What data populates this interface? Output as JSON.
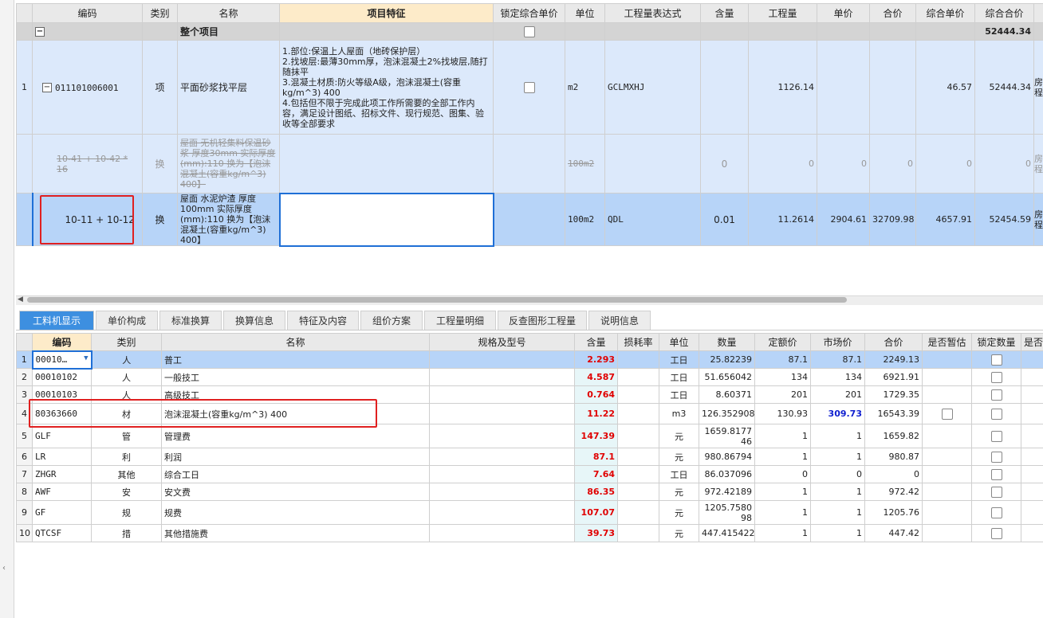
{
  "top_grid": {
    "headers": [
      "编码",
      "类别",
      "名称",
      "项目特征",
      "锁定综合单价",
      "单位",
      "工程量表达式",
      "含量",
      "工程量",
      "单价",
      "合价",
      "综合单价",
      "综合合价"
    ],
    "total_row": {
      "label": "整个项目",
      "total": "52444.34"
    },
    "row1": {
      "num": "1",
      "code": "011101006001",
      "type": "项",
      "name": "平面砂浆找平层",
      "feature": "1.部位:保温上人屋面（地砖保护层）\n2.找坡层:最薄30mm厚，泡沫混凝土2%找坡层,随打随抹平\n3.混凝土材质:防火等级A级，泡沫混凝土(容重kg/m^3) 400\n4.包括但不限于完成此项工作所需要的全部工作内容，满足设计图纸、招标文件、现行规范、图集、验收等全部要求",
      "unit": "m2",
      "expr": "GCLMXHJ",
      "quantity": "1126.14",
      "comp_price": "46.57",
      "comp_total": "52444.34",
      "extra": "房\n程"
    },
    "row2": {
      "code": "10-41 + 10-42 * 16",
      "type": "换",
      "name": "屋面 无机轻集料保温砂浆 厚度30mm  实际厚度(mm):110  换为【泡沫混凝土(容重kg/m^3) 400】",
      "unit": "100m2",
      "content": "0",
      "quantity": "0",
      "price": "0",
      "total": "0",
      "comp_price": "0",
      "comp_total": "0",
      "extra": "房\n程"
    },
    "row3": {
      "code": "10-11 + 10-12",
      "type": "换",
      "name": "屋面 水泥炉渣 厚度100mm  实际厚度(mm):110  换为【泡沫混凝土(容重kg/m^3) 400】",
      "unit": "100m2",
      "expr": "QDL",
      "content": "0.01",
      "quantity": "11.2614",
      "price": "2904.61",
      "total": "32709.98",
      "comp_price": "4657.91",
      "comp_total": "52454.59",
      "extra": "房\n程"
    }
  },
  "tabs": [
    "工料机显示",
    "单价构成",
    "标准换算",
    "换算信息",
    "特征及内容",
    "组价方案",
    "工程量明细",
    "反查图形工程量",
    "说明信息"
  ],
  "bottom_grid": {
    "headers": [
      "编码",
      "类别",
      "名称",
      "规格及型号",
      "含量",
      "损耗率",
      "单位",
      "数量",
      "定额价",
      "市场价",
      "合价",
      "是否暂估",
      "锁定数量",
      "是否"
    ],
    "rows": [
      {
        "num": "1",
        "code": "00010…",
        "type": "人",
        "name": "普工",
        "qty": "2.293",
        "unit": "工日",
        "amount": "25.82239",
        "base": "87.1",
        "market": "87.1",
        "total": "2249.13"
      },
      {
        "num": "2",
        "code": "00010102",
        "type": "人",
        "name": "一般技工",
        "qty": "4.587",
        "unit": "工日",
        "amount": "51.656042",
        "base": "134",
        "market": "134",
        "total": "6921.91"
      },
      {
        "num": "3",
        "code": "00010103",
        "type": "人",
        "name": "高级技工",
        "qty": "0.764",
        "unit": "工日",
        "amount": "8.60371",
        "base": "201",
        "market": "201",
        "total": "1729.35"
      },
      {
        "num": "4",
        "code": "80363660",
        "type": "材",
        "name": "泡沫混凝土(容重kg/m^3) 400",
        "qty": "11.22",
        "unit": "m3",
        "amount": "126.352908",
        "base": "130.93",
        "market": "309.73",
        "total": "16543.39"
      },
      {
        "num": "5",
        "code": "GLF",
        "type": "管",
        "name": "管理费",
        "qty": "147.39",
        "unit": "元",
        "amount": "1659.817746",
        "base": "1",
        "market": "1",
        "total": "1659.82"
      },
      {
        "num": "6",
        "code": "LR",
        "type": "利",
        "name": "利润",
        "qty": "87.1",
        "unit": "元",
        "amount": "980.86794",
        "base": "1",
        "market": "1",
        "total": "980.87"
      },
      {
        "num": "7",
        "code": "ZHGR",
        "type": "其他",
        "name": "综合工日",
        "qty": "7.64",
        "unit": "工日",
        "amount": "86.037096",
        "base": "0",
        "market": "0",
        "total": "0"
      },
      {
        "num": "8",
        "code": "AWF",
        "type": "安",
        "name": "安文费",
        "qty": "86.35",
        "unit": "元",
        "amount": "972.42189",
        "base": "1",
        "market": "1",
        "total": "972.42"
      },
      {
        "num": "9",
        "code": "GF",
        "type": "规",
        "name": "规费",
        "qty": "107.07",
        "unit": "元",
        "amount": "1205.758098",
        "base": "1",
        "market": "1",
        "total": "1205.76"
      },
      {
        "num": "10",
        "code": "QTCSF",
        "type": "措",
        "name": "其他措施费",
        "qty": "39.73",
        "unit": "元",
        "amount": "447.415422",
        "base": "1",
        "market": "1",
        "total": "447.42"
      }
    ]
  },
  "icons": {
    "collapse": "minus-box-icon",
    "dropdown": "chevron-down-icon",
    "scroll_left": "chevron-left-icon"
  },
  "colors": {
    "selected_row": "#b7d4f8",
    "tab_active": "#3d8fe0",
    "highlight_box": "#e02020",
    "quantity_text": "#e00000",
    "market_changed": "#1020d0"
  }
}
